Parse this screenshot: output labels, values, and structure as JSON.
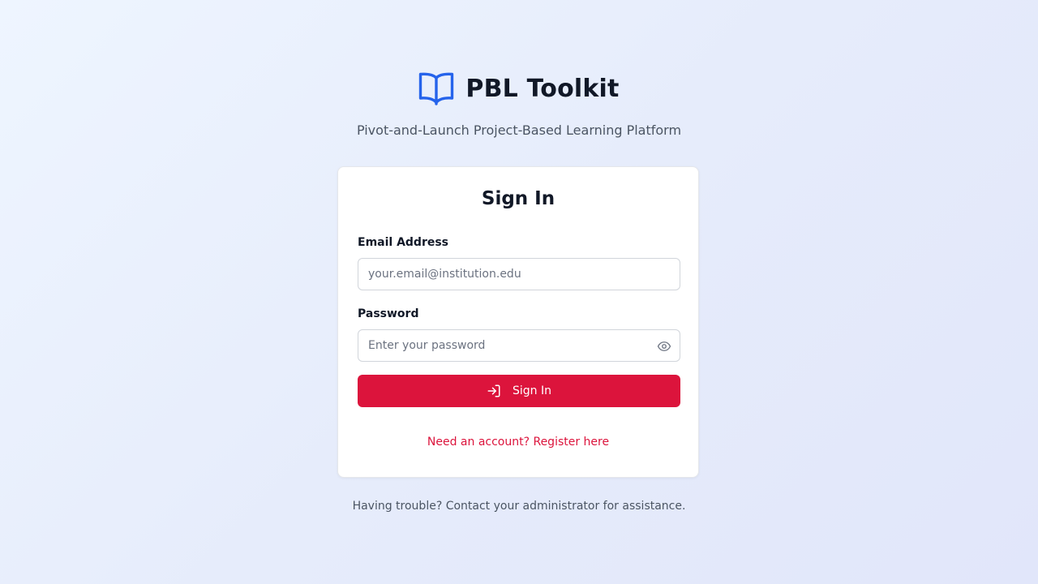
{
  "brand": {
    "icon": "open-book-icon",
    "title": "PBL Toolkit",
    "tagline": "Pivot-and-Launch Project-Based Learning Platform",
    "accent_color": "#2563eb"
  },
  "login_form": {
    "title": "Sign In",
    "email": {
      "label": "Email Address",
      "value": "",
      "placeholder": "your.email@institution.edu"
    },
    "password": {
      "label": "Password",
      "value": "",
      "placeholder": "Enter your password",
      "toggle_icon": "eye-icon"
    },
    "submit": {
      "icon": "sign-in-icon",
      "label": "Sign In",
      "color": "#dc143c"
    },
    "register_link": "Need an account? Register here"
  },
  "footer": {
    "note": "Having trouble? Contact your administrator for assistance."
  }
}
